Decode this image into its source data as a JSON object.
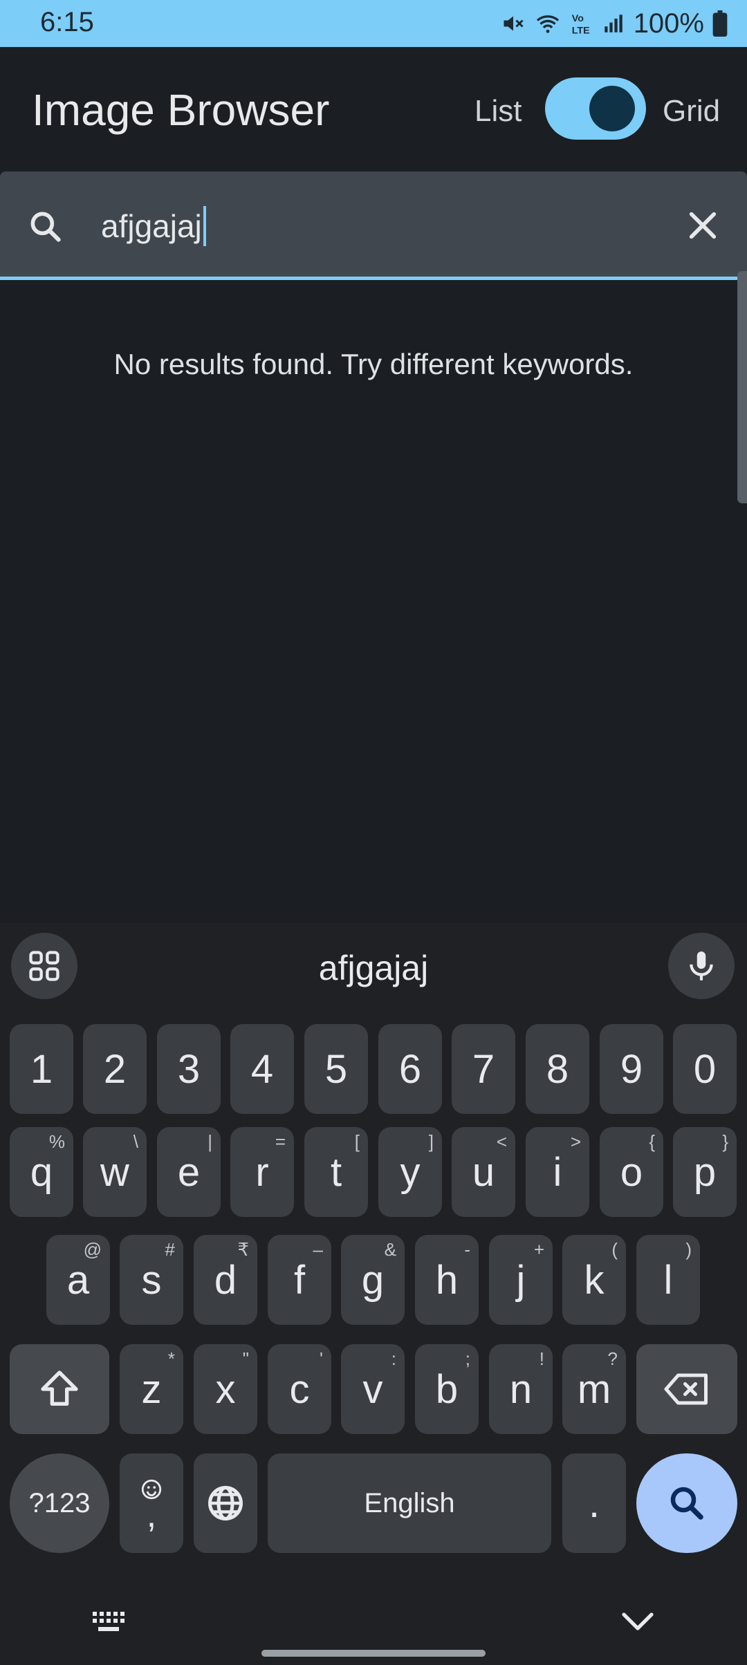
{
  "status_bar": {
    "time": "6:15",
    "battery": "100%"
  },
  "app_bar": {
    "title": "Image Browser",
    "toggle_left": "List",
    "toggle_right": "Grid"
  },
  "search": {
    "value": "afjgajaj"
  },
  "results": {
    "message": "No results found. Try different keywords."
  },
  "keyboard": {
    "suggestion": "afjgajaj",
    "number_row": [
      "1",
      "2",
      "3",
      "4",
      "5",
      "6",
      "7",
      "8",
      "9",
      "0"
    ],
    "row1": [
      {
        "k": "q",
        "s": "%"
      },
      {
        "k": "w",
        "s": "\\"
      },
      {
        "k": "e",
        "s": "|"
      },
      {
        "k": "r",
        "s": "="
      },
      {
        "k": "t",
        "s": "["
      },
      {
        "k": "y",
        "s": "]"
      },
      {
        "k": "u",
        "s": "<"
      },
      {
        "k": "i",
        "s": ">"
      },
      {
        "k": "o",
        "s": "{"
      },
      {
        "k": "p",
        "s": "}"
      }
    ],
    "row2": [
      {
        "k": "a",
        "s": "@"
      },
      {
        "k": "s",
        "s": "#"
      },
      {
        "k": "d",
        "s": "₹"
      },
      {
        "k": "f",
        "s": "–"
      },
      {
        "k": "g",
        "s": "&"
      },
      {
        "k": "h",
        "s": "-"
      },
      {
        "k": "j",
        "s": "+"
      },
      {
        "k": "k",
        "s": "("
      },
      {
        "k": "l",
        "s": ")"
      }
    ],
    "row3": [
      {
        "k": "z",
        "s": "*"
      },
      {
        "k": "x",
        "s": "\""
      },
      {
        "k": "c",
        "s": "'"
      },
      {
        "k": "v",
        "s": ":"
      },
      {
        "k": "b",
        "s": ";"
      },
      {
        "k": "n",
        "s": "!"
      },
      {
        "k": "m",
        "s": "?"
      }
    ],
    "symbols_key": "?123",
    "comma_key": ",",
    "space_key": "English",
    "period_key": "."
  },
  "icons": [
    "mute-icon",
    "wifi-icon",
    "volte-icon",
    "signal-icon",
    "battery-icon",
    "search-icon",
    "clear-icon",
    "apps-grid-icon",
    "mic-icon",
    "shift-icon",
    "backspace-icon",
    "emoji-icon",
    "globe-icon",
    "keyboard-icon",
    "chevron-down-icon"
  ],
  "colors": {
    "accent": "#7ccdf8",
    "background": "#1b1e22",
    "search_key": "#a8c7fa"
  }
}
